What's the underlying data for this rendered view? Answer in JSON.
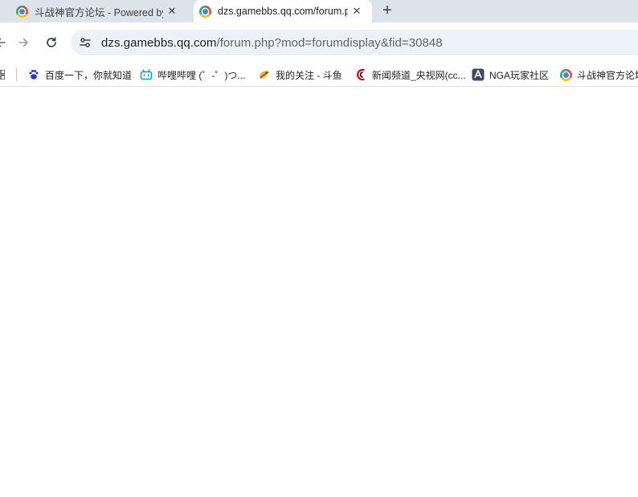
{
  "tabs": [
    {
      "title": "斗战神官方论坛 - Powered by Discuz!",
      "icon": "chrome-favicon-icon",
      "active": false
    },
    {
      "title": "dzs.gamebbs.qq.com/forum.php",
      "icon": "chrome-favicon-icon",
      "active": true
    }
  ],
  "new_tab_label": "+",
  "close_label": "✕",
  "toolbar": {
    "back_icon": "arrow-left-icon",
    "forward_icon": "arrow-right-icon",
    "reload_icon": "reload-icon",
    "site_info_icon": "tune-icon"
  },
  "address": {
    "host": "dzs.gamebbs.qq.com",
    "path": "/forum.php?mod=forumdisplay&fid=30848"
  },
  "bookmarks": [
    {
      "label": "百度一下，你就知道",
      "icon": "baidu-paw-icon"
    },
    {
      "label": "哔哩哔哩 (゜-゜)つ...",
      "icon": "bilibili-tv-icon"
    },
    {
      "label": "我的关注 - 斗鱼",
      "icon": "douyu-fish-icon"
    },
    {
      "label": "新闻频道_央视网(cc...",
      "icon": "cctv-icon"
    },
    {
      "label": "NGA玩家社区",
      "icon": "nga-icon"
    },
    {
      "label": "斗战神官方论坛",
      "icon": "chrome-favicon-icon"
    }
  ],
  "colors": {
    "tabstrip": "#dde3ea",
    "omnibox": "#edf2fa",
    "page": "#ffffff"
  }
}
